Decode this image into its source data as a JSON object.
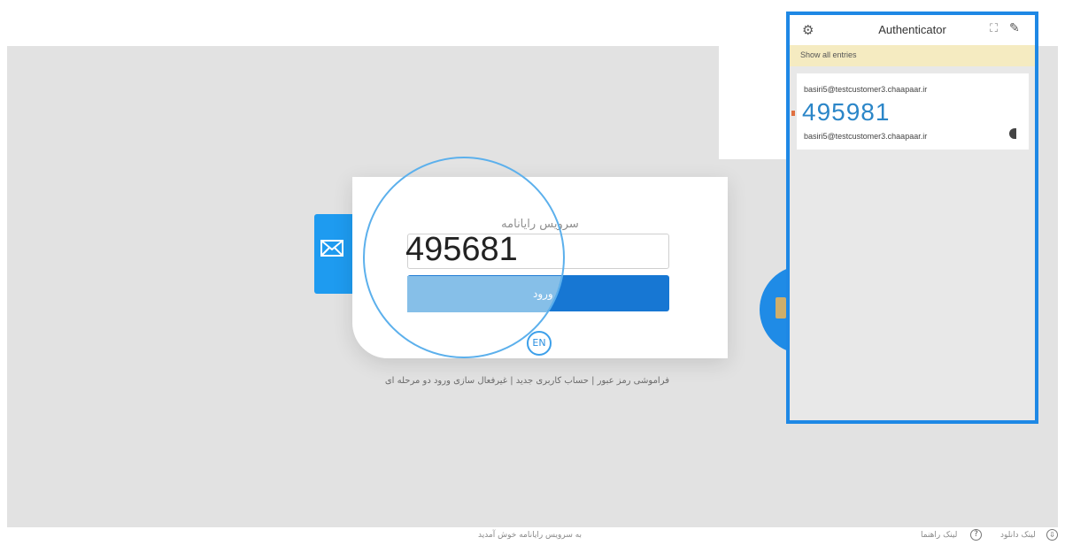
{
  "login": {
    "title": "سرویس رایانامه",
    "code_value": "495681",
    "submit_label": "ورود",
    "lang_label": "EN",
    "links": "فراموشی رمز عبور | حساب کاربری جدید | غیرفعال سازی ورود دو مرحله ای"
  },
  "footer": {
    "welcome": "به سرویس رایانامه خوش آمدید",
    "help": "لینک راهنما",
    "download": "لینک دانلود",
    "help_icon": "?",
    "download_icon": "⇩"
  },
  "authenticator": {
    "title": "Authenticator",
    "banner": "Show all entries",
    "entry": {
      "issuer": "basiri5@testcustomer3.chaapaar.ir",
      "code": "495981",
      "account": "basiri5@testcustomer3.chaapaar.ir"
    }
  },
  "icons": {
    "envelope": "envelope-icon",
    "gear": "gear-icon",
    "qr": "qr-scan-icon",
    "pencil": "pencil-icon",
    "timer": "timer-icon"
  },
  "colors": {
    "accent": "#1e88e5",
    "button": "#1777d3",
    "banner": "#f5ebc1",
    "code": "#2b86c8"
  }
}
